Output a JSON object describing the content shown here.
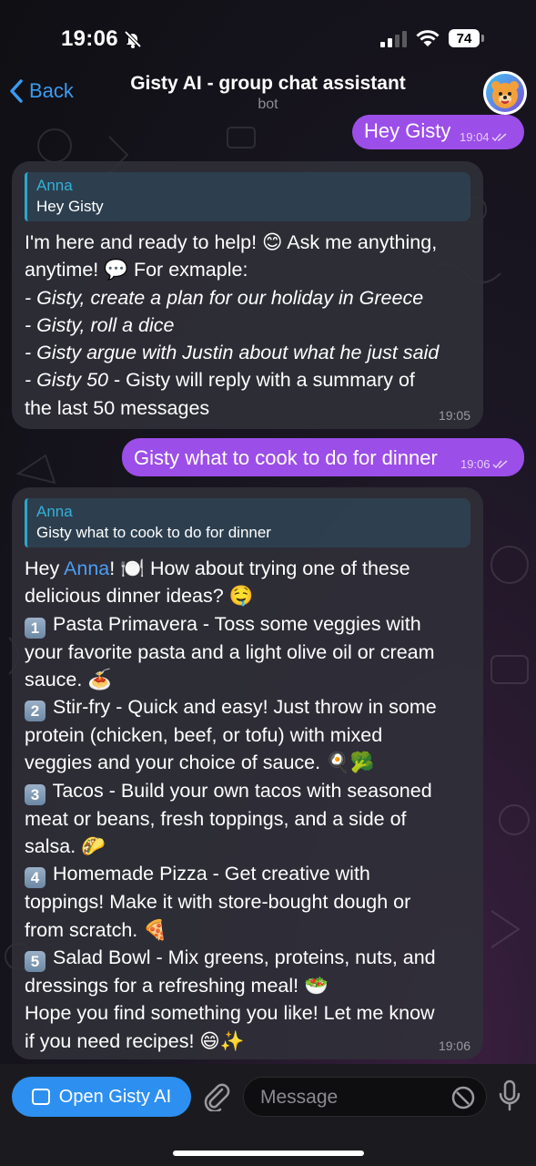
{
  "status_bar": {
    "time": "19:06",
    "battery": "74"
  },
  "header": {
    "back_label": "Back",
    "title": "Gisty AI - group chat assistant",
    "subtitle": "bot"
  },
  "messages": [
    {
      "type": "outgoing",
      "text": "Hey Gisty",
      "time": "19:04"
    },
    {
      "type": "incoming",
      "reply_to": {
        "name": "Anna",
        "text": "Hey Gisty"
      },
      "lines": [
        "I'm here and ready to help! 😊 Ask me anything,",
        "anytime! 💬 For exmaple:",
        "- Gisty, create a plan for our holiday in Greece",
        "- Gisty, roll a dice",
        "- Gisty argue with Justin about what he just said",
        "- Gisty 50",
        " - Gisty will reply with a summary of",
        "the last 50 messages"
      ],
      "time": "19:05"
    },
    {
      "type": "outgoing",
      "text": "Gisty what to cook to do for dinner",
      "time": "19:06"
    },
    {
      "type": "incoming",
      "reply_to": {
        "name": "Anna",
        "text": "Gisty what to cook to do for dinner"
      },
      "greeting_prefix": "Hey ",
      "mention": "Anna",
      "greeting_suffix": "! 🍽️ How about trying one of these",
      "lines": [
        "delicious dinner ideas? 🤤",
        "Pasta Primavera - Toss some veggies with",
        "your favorite pasta and a light olive oil or cream",
        "sauce. 🍝",
        "Stir-fry - Quick and easy! Just throw in some",
        "protein (chicken, beef, or tofu) with mixed",
        "veggies and your choice of sauce. 🍳🥦",
        "Tacos - Build your own tacos with seasoned",
        "meat or beans, fresh toppings, and a side of",
        "salsa. 🌮",
        "Homemade Pizza - Get creative with",
        "toppings! Make it with store-bought dough or",
        "from scratch. 🍕",
        "Salad Bowl - Mix greens, proteins, nuts, and",
        "dressings for a refreshing meal! 🥗",
        "Hope you find something you like! Let me know",
        "if you need recipes! 😄✨"
      ],
      "numbers": [
        "1",
        "2",
        "3",
        "4",
        "5"
      ],
      "time": "19:06"
    }
  ],
  "bottom_bar": {
    "open_button": "Open Gisty AI",
    "input_placeholder": "Message"
  },
  "colors": {
    "accent": "#2d8ff0",
    "outgoing_bubble": "#9c4ee8",
    "incoming_bubble": "#303038",
    "reply_bar": "#2fa5c9"
  }
}
